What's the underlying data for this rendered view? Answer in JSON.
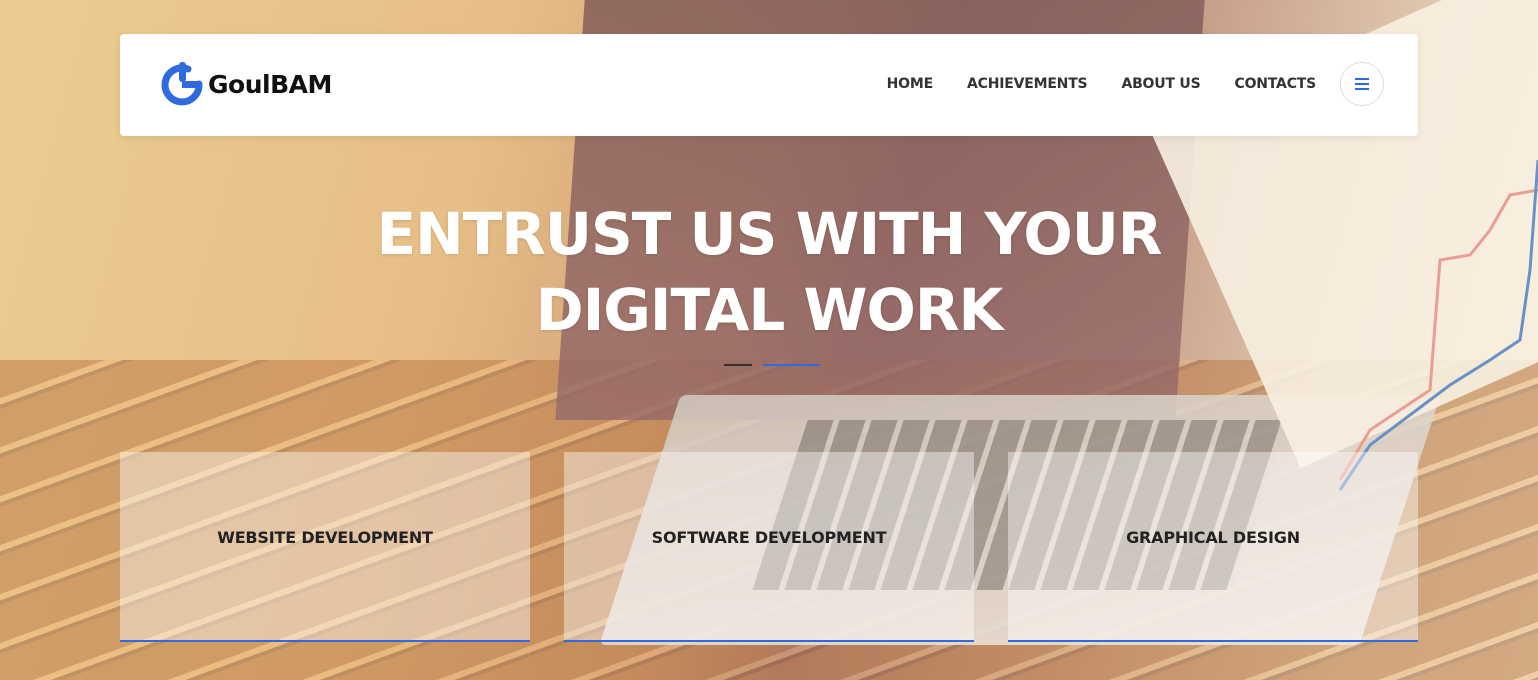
{
  "brand": {
    "name": "GoulBAM",
    "logo_icon": "power-g-icon",
    "accent_color": "#2f6bdf"
  },
  "nav": {
    "items": [
      {
        "label": "HOME"
      },
      {
        "label": "ACHIEVEMENTS"
      },
      {
        "label": "ABOUT US"
      },
      {
        "label": "CONTACTS"
      }
    ],
    "menu_icon": "hamburger-menu-icon"
  },
  "hero": {
    "title_line1": "ENTRUST US WITH YOUR",
    "title_line2": "DIGITAL WORK"
  },
  "services": [
    {
      "label": "WEBSITE DEVELOPMENT"
    },
    {
      "label": "SOFTWARE DEVELOPMENT"
    },
    {
      "label": "GRAPHICAL DESIGN"
    }
  ]
}
